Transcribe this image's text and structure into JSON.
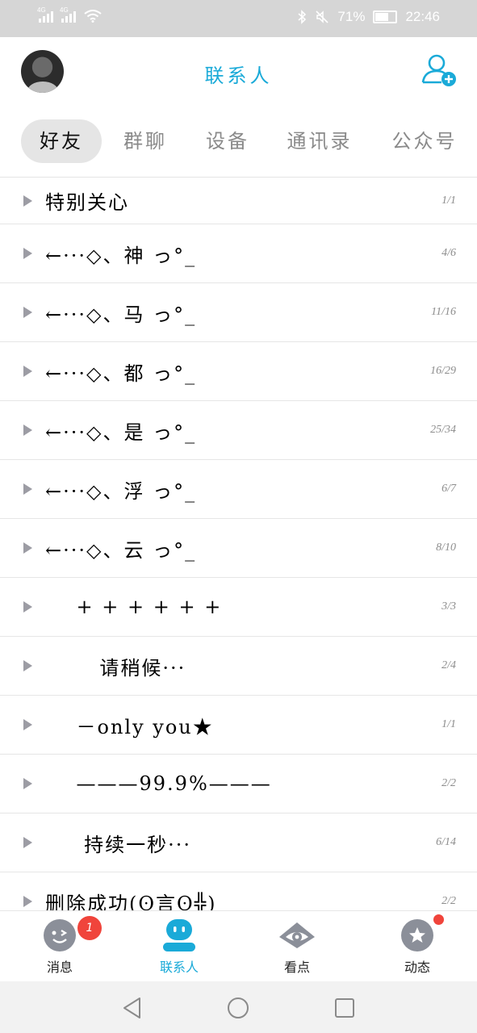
{
  "status_bar": {
    "network_1": "4G",
    "network_2": "4G",
    "battery_text": "71%",
    "battery_level": 0.71,
    "time": "22:46"
  },
  "header": {
    "title": "联系人"
  },
  "tabs": [
    {
      "label": "好友",
      "active": true
    },
    {
      "label": "群聊",
      "active": false
    },
    {
      "label": "设备",
      "active": false
    },
    {
      "label": "通讯录",
      "active": false
    },
    {
      "label": "公众号",
      "active": false
    }
  ],
  "groups": [
    {
      "name": "特别关心",
      "count": "1/1"
    },
    {
      "name": "←···◇、神 っ°_",
      "count": "4/6"
    },
    {
      "name": "←···◇、马 っ°_",
      "count": "11/16"
    },
    {
      "name": "←···◇、都 っ°_",
      "count": "16/29"
    },
    {
      "name": "←···◇、是 っ°_",
      "count": "25/34"
    },
    {
      "name": "←···◇、浮 っ°_",
      "count": "6/7"
    },
    {
      "name": "←···◇、云 っ°_",
      "count": "8/10"
    },
    {
      "name": "    + + + + + +",
      "count": "3/3"
    },
    {
      "name": "       请稍候···",
      "count": "2/4"
    },
    {
      "name": "    －only you★",
      "count": "1/1"
    },
    {
      "name": "    ———99.9%———",
      "count": "2/2"
    },
    {
      "name": "     持续一秒···",
      "count": "6/14"
    },
    {
      "name": "删除成功(ʘ言ʘ╬)",
      "count": "2/2"
    }
  ],
  "bottom_nav": {
    "messages_label": "消息",
    "messages_badge": "1",
    "contacts_label": "联系人",
    "watch_label": "看点",
    "moments_label": "动态"
  },
  "colors": {
    "accent": "#1aaad8",
    "badge": "#f0443b",
    "nav_icon_gray": "#8b8f99"
  }
}
